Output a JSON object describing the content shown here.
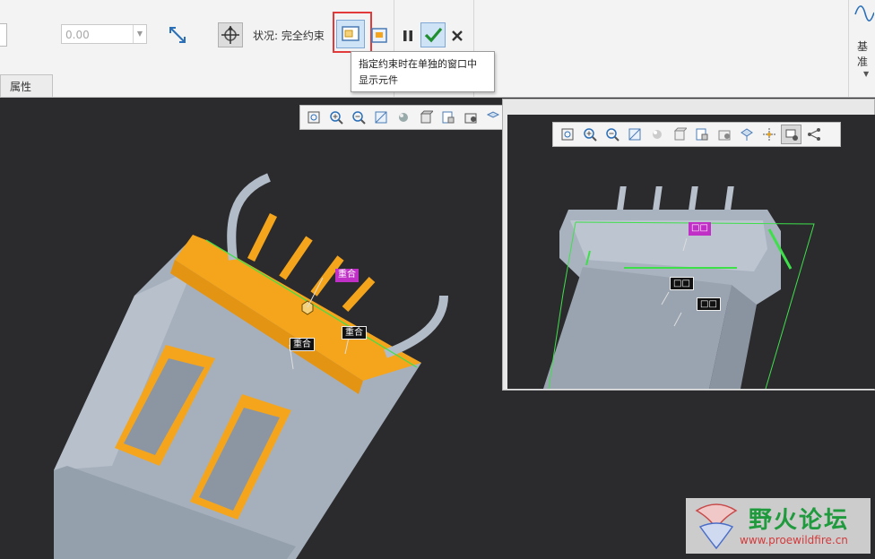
{
  "ribbon": {
    "value_field": {
      "value": "0.00"
    },
    "status_label": "状况: 完全约束",
    "tab_properties": "属性",
    "right_group_label": "基准",
    "tooltip": {
      "line1": "指定约束时在单独的窗口中",
      "line2": "显示元件"
    }
  },
  "viewport": {
    "tags": {
      "coincident_1": "重合",
      "coincident_2": "重合",
      "coincident_3": "重合"
    }
  },
  "subwindow": {
    "tags": {
      "tag_purple": "□□",
      "tag_black_1": "□□",
      "tag_black_2": "□□"
    }
  },
  "watermark": {
    "title": "野火论坛",
    "url": "www.proewildfire.cn"
  },
  "colors": {
    "accent_orange": "#f5a51c",
    "part_gray": "#a4aebb",
    "constraint_green": "#3ee04a",
    "tag_purple": "#c02fc6",
    "highlight_red": "#e23a3a"
  }
}
